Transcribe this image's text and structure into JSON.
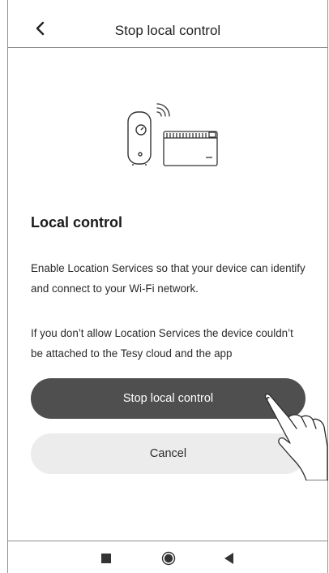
{
  "header": {
    "title": "Stop local control",
    "back_icon": "chevron-left-icon"
  },
  "illustration": {
    "icons": [
      "water-heater-icon",
      "wifi-signal-icon",
      "convector-heater-icon"
    ]
  },
  "content": {
    "section_title": "Local control",
    "paragraph1": "Enable Location Services so that your device can identify and connect to your Wi-Fi network.",
    "paragraph2": "If you don’t allow Location Services the device couldn’t be attached to the Tesy cloud and the app"
  },
  "buttons": {
    "primary_label": "Stop local control",
    "secondary_label": "Cancel"
  },
  "navbar": {
    "icons": [
      "recent-apps-icon",
      "home-icon",
      "back-triangle-icon"
    ]
  },
  "colors": {
    "primary_button": "#4f4f4f",
    "secondary_button": "#ececec",
    "divider": "#8e8e8e",
    "text": "#1f1f1f"
  }
}
